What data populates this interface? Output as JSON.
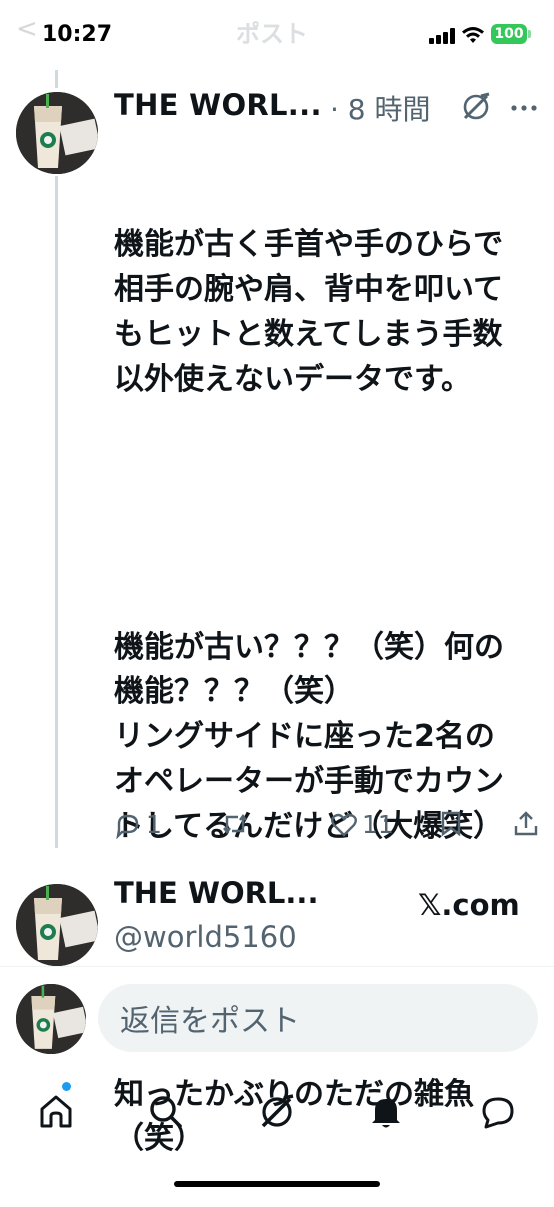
{
  "status_bar": {
    "time": "10:27",
    "battery": "100"
  },
  "header": {
    "back_icon": "chevron-left-icon",
    "title": "ポスト"
  },
  "tweet": {
    "author_name": "THE WORL...",
    "time": "· 8 時間",
    "body": [
      "機能が古く手首や手のひらで相手の腕や肩、背中を叩いてもヒットと数えてしまう手数以外使えないデータです。",
      "",
      "機能が古い？？？（笑）何の機能？？？（笑）\nリングサイドに座った2名のオペレーターが手動でカウントしてるんだけど（大爆笑）",
      "",
      "知ったかぶりのただの雑魚（笑）"
    ],
    "reply_count": "1",
    "like_count": "11"
  },
  "quoted_author": {
    "name": "THE WORL...",
    "handle": "@world5160",
    "watermark": "𝕏.com"
  },
  "reply_bar": {
    "placeholder": "返信をポスト"
  },
  "tab_bar": {
    "items": [
      "home-icon",
      "search-icon",
      "grok-icon",
      "notifications-icon",
      "messages-icon"
    ]
  },
  "colors": {
    "accent": "#1d9bf0",
    "secondary_text": "#536471",
    "battery": "#34c759"
  }
}
